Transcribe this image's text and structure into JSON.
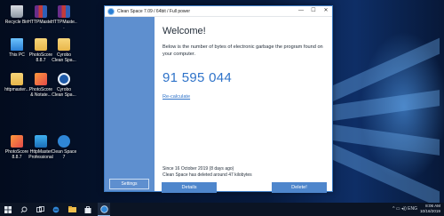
{
  "desktop": {
    "icons": [
      {
        "label": "Recycle Bin"
      },
      {
        "label": "HTTPMaste..."
      },
      {
        "label": "HTTPMaste..."
      },
      {
        "label": "This PC"
      },
      {
        "label": "PhotoScore 8.8.7"
      },
      {
        "label": "Cyrobo Clean Spa..."
      },
      {
        "label": "httpmaster..."
      },
      {
        "label": "PhotoScore & Notate..."
      },
      {
        "label": "Cyrobo Clean Spa..."
      },
      {
        "label": "PhotoScore 8.8.7"
      },
      {
        "label": "HttpMaster Professional"
      },
      {
        "label": "Clean Space 7"
      }
    ]
  },
  "window": {
    "title": "Clean Space 7.09 / 64bit / Full power",
    "controls": {
      "minimize": "—",
      "maximize": "☐",
      "close": "✕"
    },
    "sidebar": {
      "settings_label": "Settings"
    },
    "welcome": "Welcome!",
    "description": "Below is the number of bytes of electronic garbage the program found on your computer.",
    "bytes": "91 595 044",
    "recalculate_label": "Re-calculate",
    "since_line1": "Since 16 October 2019 (8 days ago)",
    "since_line2": "Clean Space has deleted around 47 kilobytes",
    "details_label": "Details",
    "delete_label": "Delete!"
  },
  "taskbar": {
    "start_icon": "windows-logo-icon",
    "time": "8:06 AM",
    "date": "10/16/2019",
    "tray": "^  ▭  ◂))  ENG"
  },
  "colors": {
    "sidebar": "#5e8fcf",
    "accent": "#2f73c9",
    "button": "#4e86cc"
  }
}
